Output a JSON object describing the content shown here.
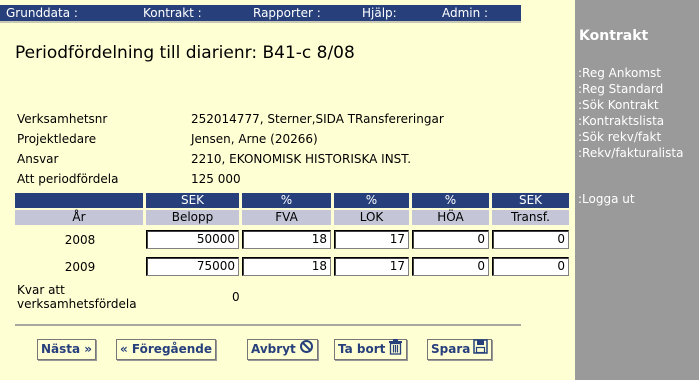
{
  "topnav": {
    "items": [
      "Grunddata :",
      "Kontrakt :",
      "Rapporter :",
      "Hjälp:",
      "Admin :"
    ]
  },
  "sidebar": {
    "title": "Kontrakt",
    "links": [
      ":Reg Ankomst",
      ":Reg Standard",
      ":Sök Kontrakt",
      ":Kontraktslista",
      ":Sök rekv/fakt",
      ":Rekv/fakturalista"
    ],
    "logout": ":Logga ut"
  },
  "page": {
    "title": "Periodfördelning till diarienr: B41-c 8/08"
  },
  "info": [
    {
      "label": "Verksamhetsnr",
      "value": "252014777, Sterner,SIDA TRansfereringar"
    },
    {
      "label": "Projektledare",
      "value": "Jensen, Arne (20266)"
    },
    {
      "label": "Ansvar",
      "value": "2210, EKONOMISK HISTORISKA INST."
    },
    {
      "label": "Att periodfördela",
      "value": "125 000"
    }
  ],
  "table": {
    "units": [
      "",
      "SEK",
      "%",
      "%",
      "%",
      "SEK"
    ],
    "columns": [
      "År",
      "Belopp",
      "FVA",
      "LOK",
      "HÖA",
      "Transf."
    ],
    "rows": [
      {
        "year": "2008",
        "belopp": "50000",
        "fva": "18",
        "lok": "17",
        "hoa": "0",
        "transf": "0"
      },
      {
        "year": "2009",
        "belopp": "75000",
        "fva": "18",
        "lok": "17",
        "hoa": "0",
        "transf": "0"
      }
    ]
  },
  "kvar": {
    "label_line1": "Kvar att",
    "label_line2": "verksamhetsfördela",
    "value": "0"
  },
  "buttons": {
    "next": "Nästa »",
    "prev": "« Föregående",
    "cancel": "Avbryt",
    "delete": "Ta bort",
    "save": "Spara"
  },
  "colors": {
    "navy": "#27407c",
    "background": "#ffffd4",
    "sidebar": "#9a9a9a",
    "subheader": "#c4c6d8"
  }
}
